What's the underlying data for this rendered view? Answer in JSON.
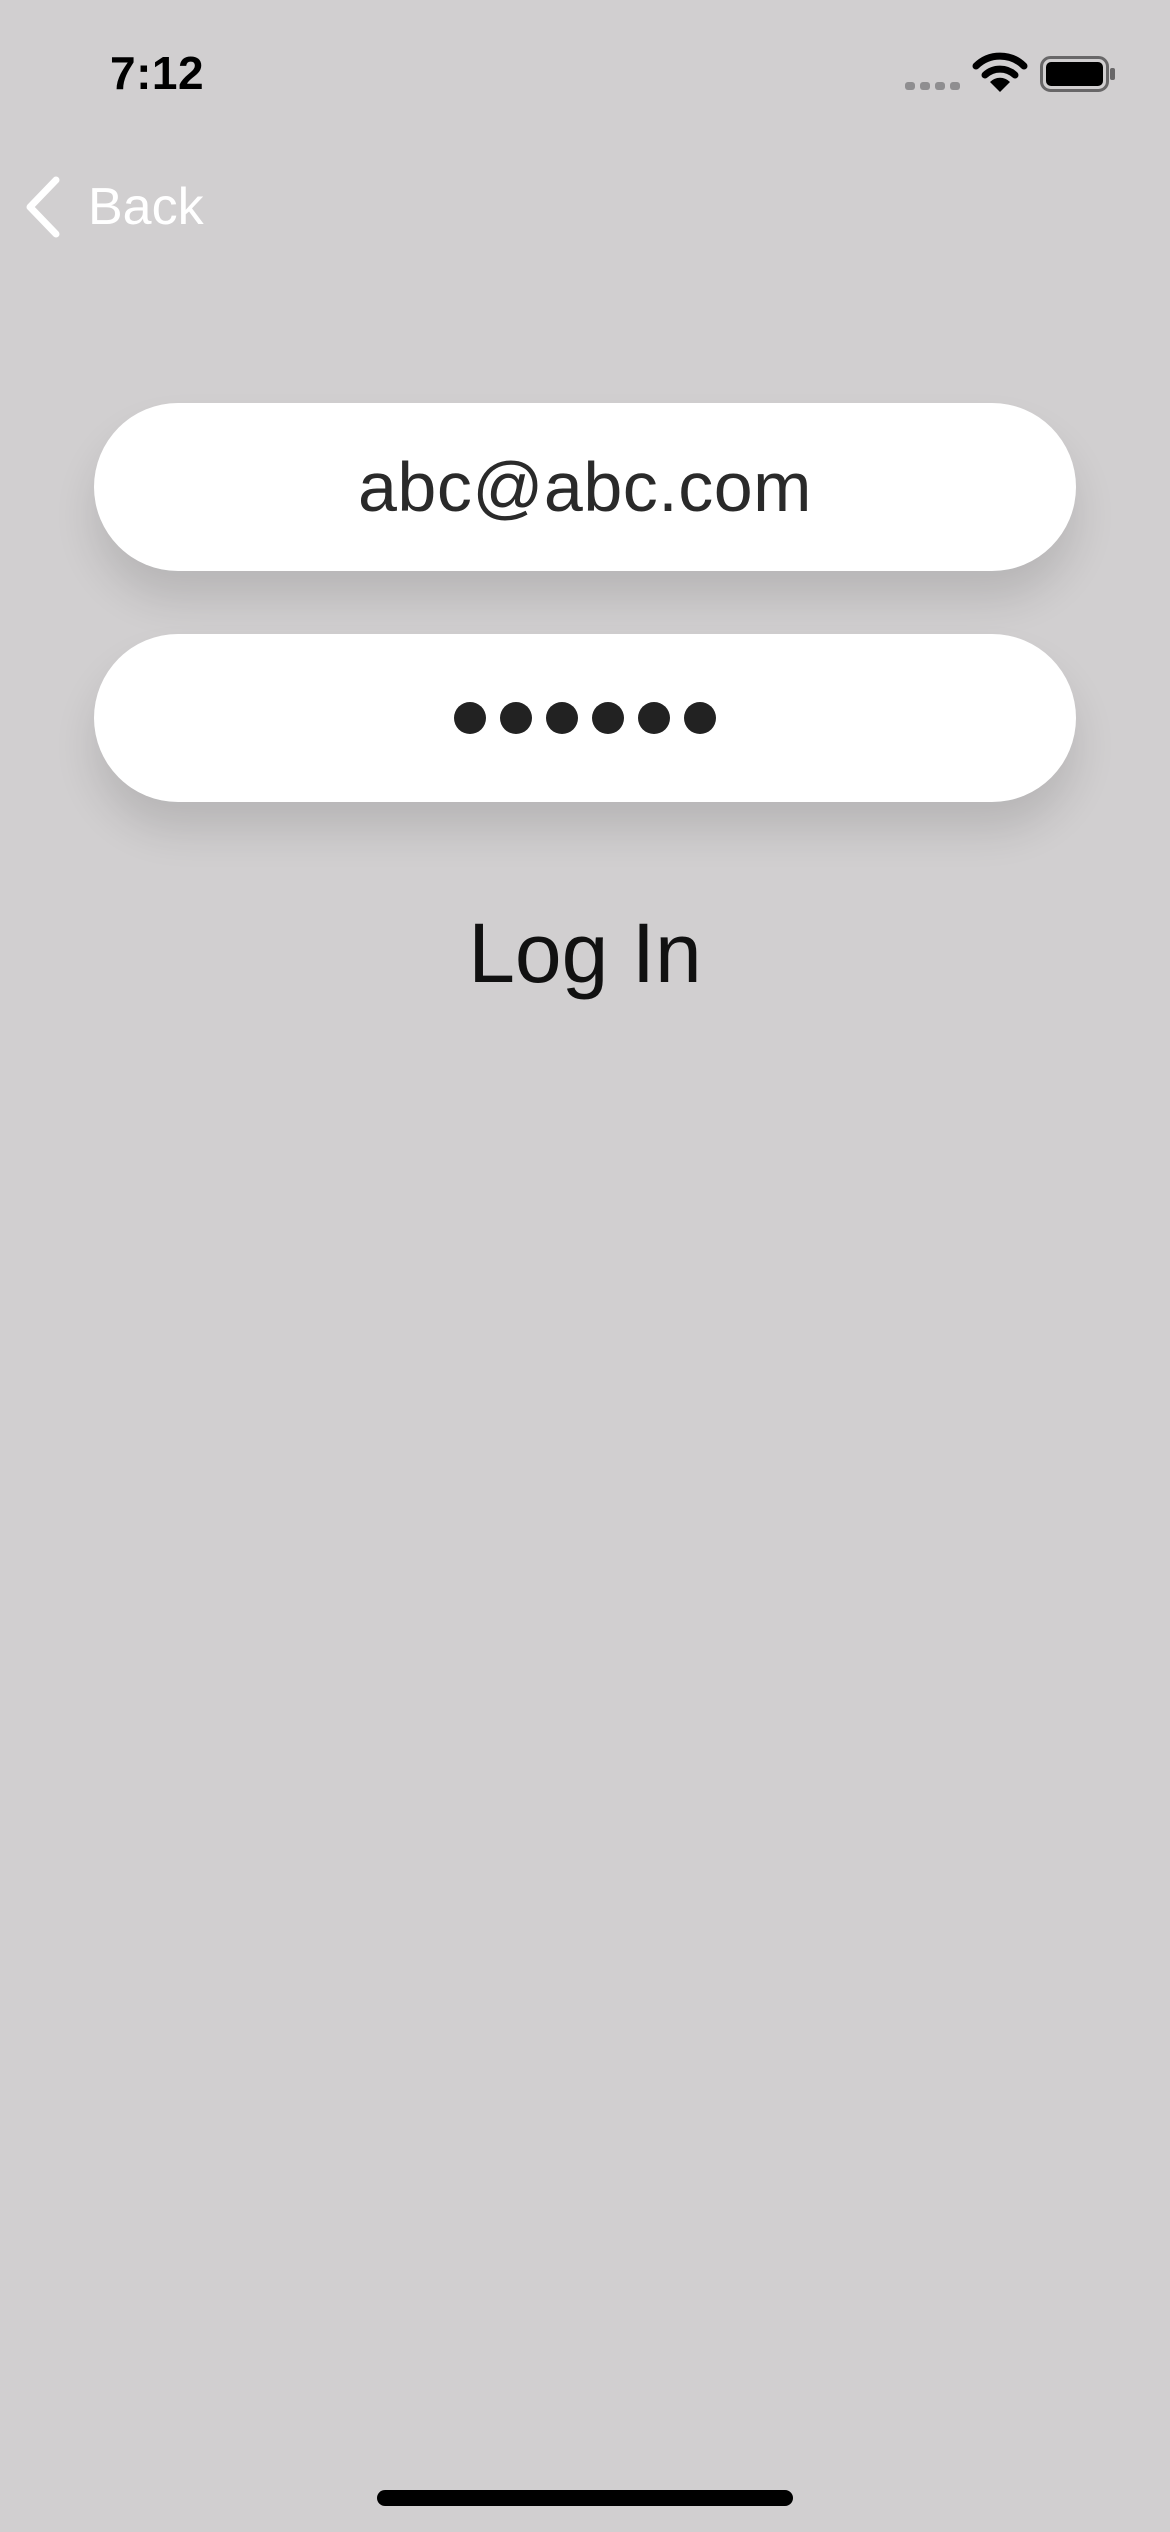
{
  "status_bar": {
    "time": "7:12",
    "icons": [
      "signal-icon",
      "wifi-icon",
      "battery-icon"
    ]
  },
  "nav": {
    "back_label": "Back",
    "back_icon": "chevron-left-icon"
  },
  "form": {
    "email_value": "abc@abc.com",
    "password_length": 6,
    "login_label": "Log In"
  },
  "colors": {
    "background": "#d1cfd0",
    "field": "#ffffff",
    "back_label": "#ffffff",
    "text": "#111111"
  }
}
